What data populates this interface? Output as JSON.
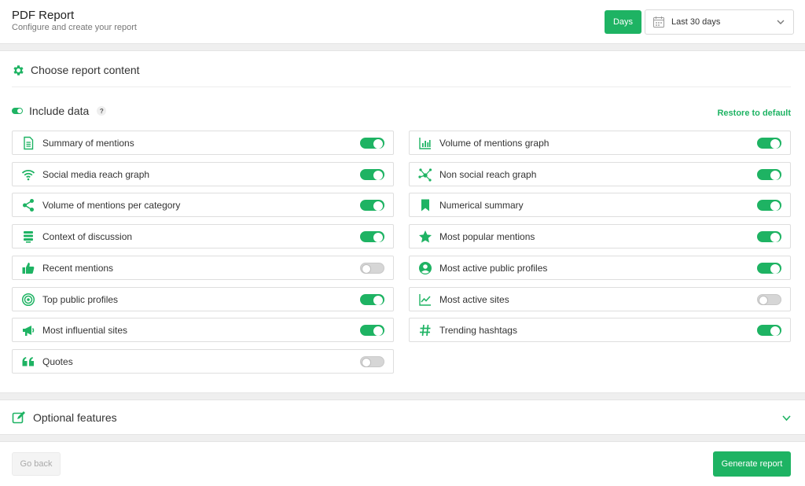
{
  "header": {
    "title": "PDF Report",
    "subtitle": "Configure and create your report",
    "days_label": "Days",
    "range_value": "Last 30 days"
  },
  "content": {
    "section_title": "Choose report content",
    "include_label": "Include data",
    "help_glyph": "?",
    "restore_label": "Restore to default"
  },
  "options_left": [
    {
      "label": "Summary of mentions",
      "icon": "document-icon",
      "on": true
    },
    {
      "label": "Social media reach graph",
      "icon": "wifi-icon",
      "on": true
    },
    {
      "label": "Volume of mentions per category",
      "icon": "share-icon",
      "on": true
    },
    {
      "label": "Context of discussion",
      "icon": "stack-icon",
      "on": true
    },
    {
      "label": "Recent mentions",
      "icon": "thumbs-up-icon",
      "on": false
    },
    {
      "label": "Top public profiles",
      "icon": "target-icon",
      "on": true
    },
    {
      "label": "Most influential sites",
      "icon": "megaphone-icon",
      "on": true
    },
    {
      "label": "Quotes",
      "icon": "quote-icon",
      "on": false
    }
  ],
  "options_right": [
    {
      "label": "Volume of mentions graph",
      "icon": "bar-chart-icon",
      "on": true
    },
    {
      "label": "Non social reach graph",
      "icon": "network-icon",
      "on": true
    },
    {
      "label": "Numerical summary",
      "icon": "bookmark-icon",
      "on": true
    },
    {
      "label": "Most popular mentions",
      "icon": "star-icon",
      "on": true
    },
    {
      "label": "Most active public profiles",
      "icon": "user-circle-icon",
      "on": true
    },
    {
      "label": "Most active sites",
      "icon": "line-chart-icon",
      "on": false
    },
    {
      "label": "Trending hashtags",
      "icon": "hashtag-icon",
      "on": true
    }
  ],
  "optional": {
    "label": "Optional features"
  },
  "footer": {
    "back_label": "Go back",
    "generate_label": "Generate report"
  },
  "colors": {
    "accent": "#1eb363",
    "toggle_off": "#d6d6d6"
  }
}
